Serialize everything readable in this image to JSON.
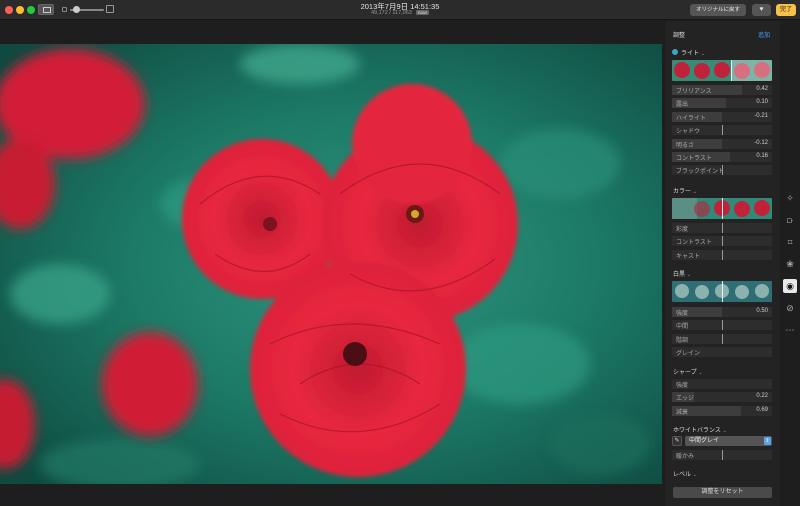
{
  "window": {
    "date_title": "2013年7月9日 14:51:35",
    "subtitle": "49,172 / 117,063",
    "raw_badge": "RAW",
    "revert_label": "オリジナルに戻す",
    "favorite_icon": "heart-icon",
    "done_label": "完了"
  },
  "panel": {
    "title": "調整",
    "add_label": "追加",
    "light": {
      "title": "ライト",
      "rows": [
        {
          "label": "ブリリアンス",
          "value": "0.42"
        },
        {
          "label": "露出",
          "value": "0.10"
        },
        {
          "label": "ハイライト",
          "value": "-0.21"
        },
        {
          "label": "シャドウ",
          "value": ""
        },
        {
          "label": "明るさ",
          "value": "-0.12"
        },
        {
          "label": "コントラスト",
          "value": "0.16"
        },
        {
          "label": "ブラックポイント",
          "value": ""
        }
      ]
    },
    "color": {
      "title": "カラー",
      "rows": [
        {
          "label": "彩度",
          "value": ""
        },
        {
          "label": "コントラスト",
          "value": ""
        },
        {
          "label": "キャスト",
          "value": ""
        }
      ]
    },
    "bw": {
      "title": "白黒",
      "rows": [
        {
          "label": "強度",
          "value": "0.50"
        },
        {
          "label": "中間",
          "value": ""
        },
        {
          "label": "階調",
          "value": ""
        },
        {
          "label": "グレイン",
          "value": ""
        }
      ]
    },
    "sharpen": {
      "title": "シャープ",
      "rows": [
        {
          "label": "強度",
          "value": ""
        },
        {
          "label": "エッジ",
          "value": "0.22"
        },
        {
          "label": "減衰",
          "value": "0.69"
        }
      ]
    },
    "white_balance": {
      "title": "ホワイトバランス",
      "select_value": "中間グレイ",
      "rows": [
        {
          "label": "暖かみ",
          "value": ""
        }
      ]
    },
    "levels": {
      "title": "レベル"
    },
    "reset_label": "調整をリセット"
  },
  "tools": [
    "magic-wand-icon",
    "crop-icon",
    "rotate-crop-icon",
    "filters-icon",
    "adjust-icon",
    "bandage-icon",
    "more-icon"
  ],
  "colors": {
    "accent": "#4aa3ff",
    "done": "#f7c24a",
    "toggle": "#3aa7c8"
  }
}
